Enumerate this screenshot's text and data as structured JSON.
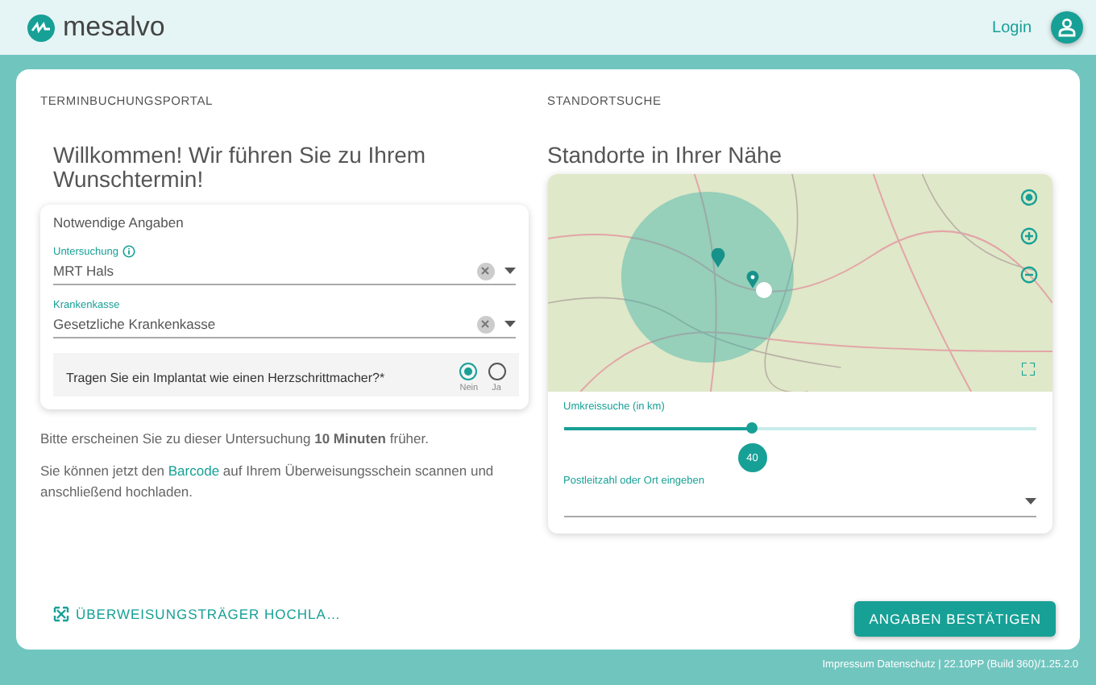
{
  "header": {
    "logo": "mesalvo",
    "login": "Login"
  },
  "left": {
    "section_title": "TERMINBUCHUNGSPORTAL",
    "heading": "Willkommen! Wir führen Sie zu Ihrem Wunschtermin!",
    "form": {
      "title": "Notwendige Angaben",
      "fields": [
        {
          "label": "Untersuchung",
          "info": true,
          "value": "MRT Hals"
        },
        {
          "label": "Krankenkasse",
          "info": false,
          "value": "Gesetzliche Krankenkasse"
        }
      ],
      "question": {
        "text": "Tragen Sie ein Implantat wie einen Herzschrittmacher?*",
        "options": [
          {
            "label": "Nein",
            "selected": true
          },
          {
            "label": "Ja",
            "selected": false
          }
        ]
      }
    },
    "note": "Bitte erscheinen Sie zu dieser Untersuchung **10 Minuten** früher.",
    "barcode_note": {
      "before": "Sie können jetzt den",
      "link": "Barcode",
      "after": "auf Ihrem Überweisungsschein scannen und anschließend hochladen."
    },
    "upload_button": "ÜBERWEISUNGSTRÄGER HOCHLA…"
  },
  "right": {
    "section_title": "STANDORTSUCHE",
    "heading": "Standorte in Ihrer Nähe",
    "radius": {
      "label": "Umkreissuche (in km)",
      "level": 0.4,
      "value": "40"
    },
    "location": {
      "label": "Postleitzahl oder Ort eingeben"
    },
    "confirm_button": "ANGABEN BESTÄTIGEN"
  },
  "footer": "Impressum Datenschutz | 22.10PP (Build 360)/1.25.2.0"
}
